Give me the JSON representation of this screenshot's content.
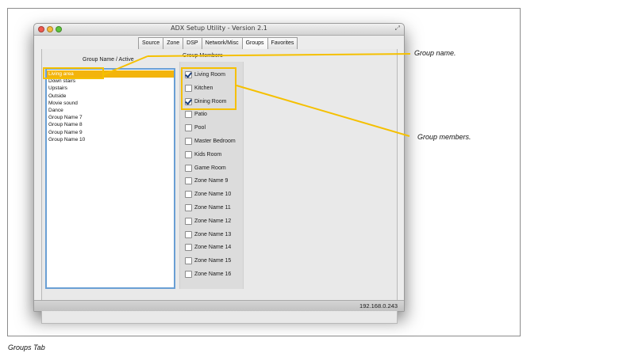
{
  "window": {
    "title": "ADX Setup Utility - Version 2.1",
    "resize_glyph": "⤢"
  },
  "tabs": [
    {
      "label": "Source",
      "active": false
    },
    {
      "label": "Zone",
      "active": false
    },
    {
      "label": "DSP",
      "active": false
    },
    {
      "label": "Network/Misc",
      "active": false
    },
    {
      "label": "Groups",
      "active": true
    },
    {
      "label": "Favorites",
      "active": false
    }
  ],
  "groups": {
    "header": "Group Name / Active",
    "selected_index": 0,
    "items": [
      "Living area",
      "Down stairs",
      "Upstairs",
      "Outside",
      "Movie sound",
      "Dance",
      "Group Name 7",
      "Group Name 8",
      "Group Name 9",
      "Group Name 10"
    ]
  },
  "members": {
    "header": "Group Members",
    "items": [
      {
        "label": "Living Room",
        "checked": true
      },
      {
        "label": "Kitchen",
        "checked": false
      },
      {
        "label": "Dining Room",
        "checked": true
      },
      {
        "label": "Patio",
        "checked": false
      },
      {
        "label": "Pool",
        "checked": false
      },
      {
        "label": "Master Bedroom",
        "checked": false
      },
      {
        "label": "Kids Room",
        "checked": false
      },
      {
        "label": "Game Room",
        "checked": false
      },
      {
        "label": "Zone Name 9",
        "checked": false
      },
      {
        "label": "Zone Name 10",
        "checked": false
      },
      {
        "label": "Zone Name 11",
        "checked": false
      },
      {
        "label": "Zone Name 12",
        "checked": false
      },
      {
        "label": "Zone Name 13",
        "checked": false
      },
      {
        "label": "Zone Name 14",
        "checked": false
      },
      {
        "label": "Zone Name 15",
        "checked": false
      },
      {
        "label": "Zone Name 16",
        "checked": false
      }
    ]
  },
  "status": {
    "ip": "192.168.0.243"
  },
  "callouts": {
    "group_name": "Group name.",
    "group_members": "Group members."
  },
  "caption": "Groups Tab",
  "colors": {
    "highlight": "#f5c000",
    "selection": "#f3b40b",
    "list_border": "#6a9fd4"
  }
}
